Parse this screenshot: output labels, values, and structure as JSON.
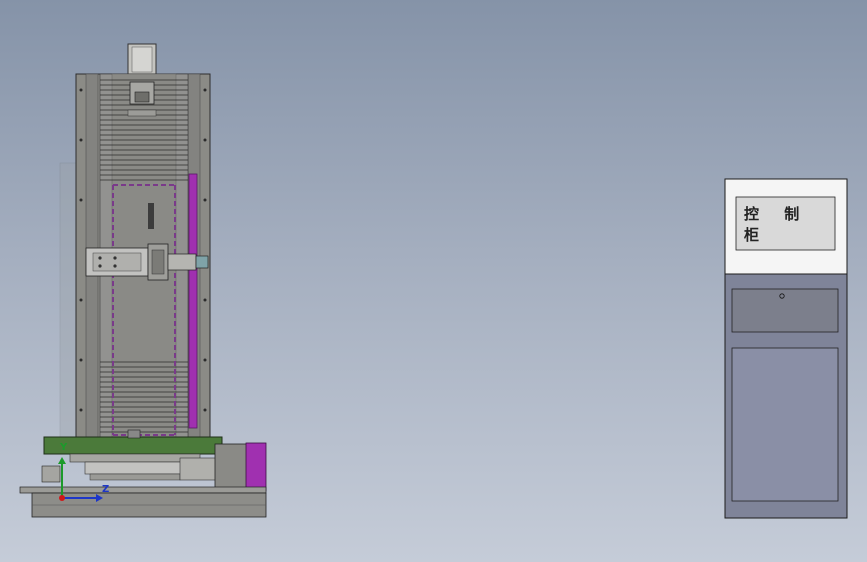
{
  "cabinet": {
    "label": "控 制 柜"
  },
  "triad": {
    "y_label": "Y",
    "z_label": "Z"
  },
  "colors": {
    "background_top": "#8593a8",
    "background_bottom": "#c5ccd8",
    "frame": "#7f7f7b",
    "green_plate": "#4b7a3a",
    "accent_purple": "#a030b0",
    "cabinet_body": "#8a8fa6",
    "axis_y": "#1c9a2a",
    "axis_z": "#1d36c8",
    "axis_x": "#d01818"
  }
}
